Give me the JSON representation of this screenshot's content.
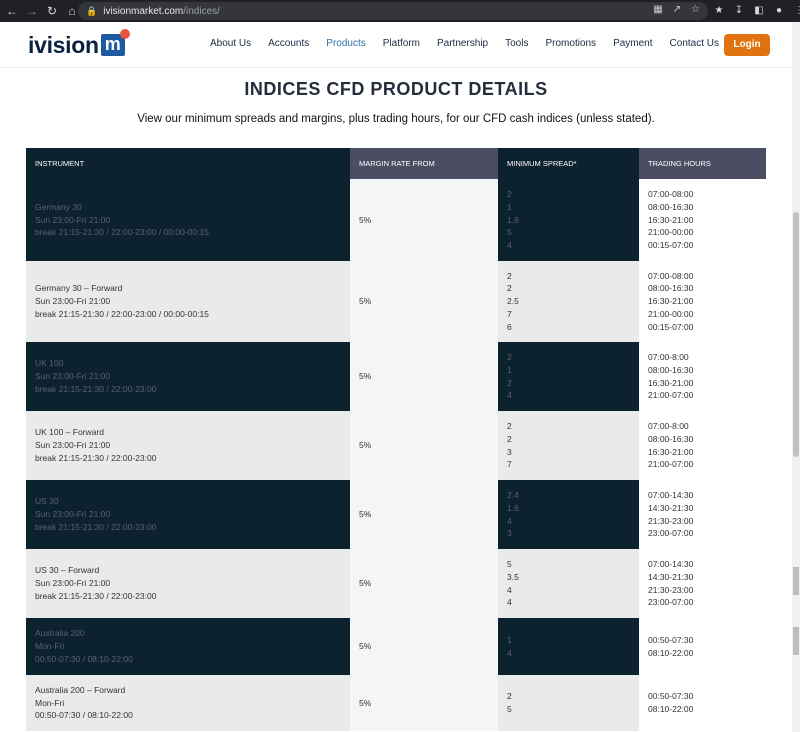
{
  "browser": {
    "url_host": "ivisionmarket.com",
    "url_path": "/indices/"
  },
  "header": {
    "logo_text": "ivision",
    "logo_mark": "m",
    "menu": [
      "About Us",
      "Accounts",
      "Products",
      "Platform",
      "Partnership",
      "Tools",
      "Promotions",
      "Payment",
      "Contact Us"
    ],
    "active_menu": "Products",
    "login_label": "Login",
    "accent_color": "#e0720f",
    "brand_color": "#0a2240"
  },
  "page": {
    "title": "INDICES CFD PRODUCT DETAILS",
    "subtitle": "View our minimum spreads and margins, plus trading hours, for our CFD cash indices (unless stated)."
  },
  "table": {
    "headers": [
      "INSTRUMENT",
      "MARGIN RATE FROM",
      "MINIMUM SPREAD*",
      "TRADING HOURS"
    ],
    "rows": [
      {
        "style": "dark",
        "instrument": [
          "Germany 30",
          "Sun 23:00-Fri 21:00",
          "break 21:15-21:30 / 22:00-23:00 / 00:00-00:15"
        ],
        "margin": "5%",
        "spread": [
          "2",
          "1",
          "1.8",
          "5",
          "4"
        ],
        "hours": [
          "07:00-08:00",
          "08:00-16:30",
          "16:30-21:00",
          "21:00-00:00",
          "00:15-07:00"
        ]
      },
      {
        "style": "light",
        "instrument": [
          "Germany 30 – Forward",
          "Sun 23:00-Fri 21:00",
          "break 21:15-21:30 / 22:00-23:00 / 00:00-00:15"
        ],
        "margin": "5%",
        "spread": [
          "2",
          "2",
          "2.5",
          "7",
          "6"
        ],
        "hours": [
          "07:00-08:00",
          "08:00-16:30",
          "16:30-21:00",
          "21:00-00:00",
          "00:15-07:00"
        ]
      },
      {
        "style": "dark",
        "instrument": [
          "UK 100",
          "Sun 23:00-Fri 21:00",
          "break 21:15-21:30 / 22:00-23:00"
        ],
        "margin": "5%",
        "spread": [
          "2",
          "1",
          "2",
          "4"
        ],
        "hours": [
          "07:00-8:00",
          "08:00-16:30",
          "16:30-21:00",
          "21:00-07:00"
        ]
      },
      {
        "style": "light",
        "instrument": [
          "UK 100 – Forward",
          "Sun 23:00-Fri 21:00",
          "break 21:15-21:30 / 22:00-23:00"
        ],
        "margin": "5%",
        "spread": [
          "2",
          "2",
          "3",
          "7"
        ],
        "hours": [
          "07:00-8:00",
          "08:00-16:30",
          "16:30-21:00",
          "21:00-07:00"
        ]
      },
      {
        "style": "dark",
        "instrument": [
          "US 30",
          "Sun 23:00-Fri 21:00",
          "break 21:15-21:30 / 22:00-23:00"
        ],
        "margin": "5%",
        "spread": [
          "2.4",
          "1.6",
          "4",
          "3"
        ],
        "hours": [
          "07:00-14:30",
          "14:30-21:30",
          "21:30-23:00",
          "23:00-07:00"
        ]
      },
      {
        "style": "light",
        "instrument": [
          "US 30 – Forward",
          "Sun 23:00-Fri 21:00",
          "break 21:15-21:30 / 22:00-23:00"
        ],
        "margin": "5%",
        "spread": [
          "5",
          "3.5",
          "4",
          "4"
        ],
        "hours": [
          "07:00-14:30",
          "14:30-21:30",
          "21:30-23:00",
          "23:00-07:00"
        ]
      },
      {
        "style": "dark",
        "instrument": [
          "Australia 200",
          "Mon-Fri",
          "00:50-07:30 / 08:10-22:00"
        ],
        "margin": "5%",
        "spread": [
          "1",
          "4"
        ],
        "hours": [
          "00:50-07:30",
          "08:10-22:00"
        ]
      },
      {
        "style": "light",
        "instrument": [
          "Australia 200 – Forward",
          "Mon-Fri",
          "00:50-07:30 / 08:10-22:00"
        ],
        "margin": "5%",
        "spread": [
          "2",
          "5"
        ],
        "hours": [
          "00:50-07:30",
          "08:10-22:00"
        ]
      }
    ]
  }
}
